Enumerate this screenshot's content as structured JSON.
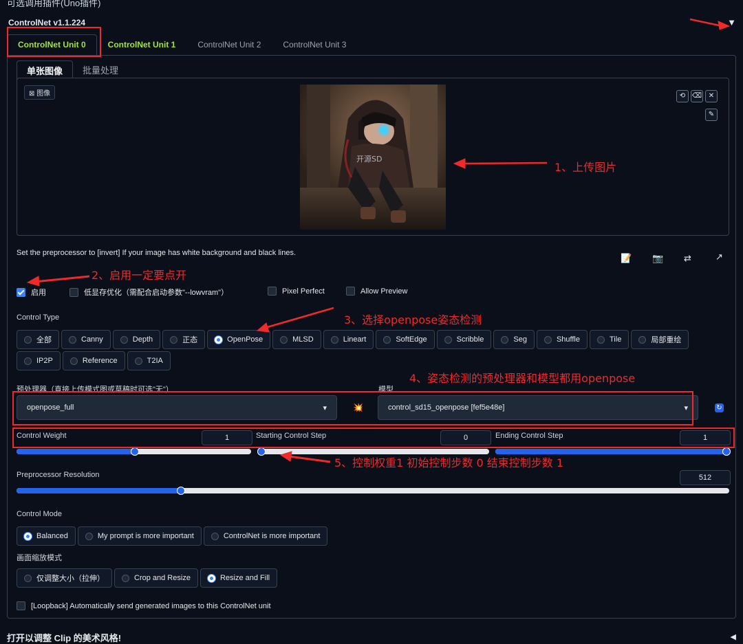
{
  "header": {
    "top_strip": "可选调用插件(Uno插件)",
    "title": "ControlNet v1.1.224",
    "collapse_icon": "triangle-down-icon"
  },
  "tabs": [
    "ControlNet Unit 0",
    "ControlNet Unit 1",
    "ControlNet Unit 2",
    "ControlNet Unit 3"
  ],
  "subtabs": [
    "单张图像",
    "批量处理"
  ],
  "image_panel": {
    "label": "图像",
    "watermark": "开源SD",
    "tool_icons": [
      "rotate-icon",
      "erase-icon",
      "close-icon",
      "brush-icon"
    ]
  },
  "hint": "Set the preprocessor to [invert] If your image has white background and black lines.",
  "tool_row_icons": [
    "📝",
    "📷",
    "⇄",
    "↗"
  ],
  "checkboxes": [
    {
      "label": "启用",
      "checked": true
    },
    {
      "label": "低显存优化（需配合启动参数\"--lowvram\"）",
      "checked": false
    },
    {
      "label": "Pixel Perfect",
      "checked": false
    },
    {
      "label": "Allow Preview",
      "checked": false
    }
  ],
  "control_type": {
    "label": "Control Type",
    "options": [
      "全部",
      "Canny",
      "Depth",
      "正态",
      "OpenPose",
      "MLSD",
      "Lineart",
      "SoftEdge",
      "Scribble",
      "Seg",
      "Shuffle",
      "Tile",
      "局部重绘",
      "IP2P",
      "Reference",
      "T2IA"
    ],
    "selected": "OpenPose"
  },
  "preprocessor": {
    "label": "预处理器（直接上传模式图或草稿时可选\"无\"）",
    "value": "openpose_full"
  },
  "model": {
    "label": "模型",
    "value": "control_sd15_openpose [fef5e48e]"
  },
  "run_icon": "💥",
  "refresh_icon": "refresh-icon",
  "sliders": {
    "control_weight": {
      "label": "Control Weight",
      "value": "1",
      "fraction": 0.5
    },
    "starting_step": {
      "label": "Starting Control Step",
      "value": "0",
      "fraction": 0.0
    },
    "ending_step": {
      "label": "Ending Control Step",
      "value": "1",
      "fraction": 1.0
    },
    "resolution": {
      "label": "Preprocessor Resolution",
      "value": "512",
      "fraction": 0.23
    }
  },
  "control_mode": {
    "label": "Control Mode",
    "options": [
      "Balanced",
      "My prompt is more important",
      "ControlNet is more important"
    ],
    "selected": "Balanced"
  },
  "resize_mode": {
    "label": "画面缩放模式",
    "options": [
      "仅调整大小（拉伸）",
      "Crop and Resize",
      "Resize and Fill"
    ],
    "selected": "Resize and Fill"
  },
  "loopback": {
    "label": "[Loopback] Automatically send generated images to this ControlNet unit",
    "checked": false
  },
  "footer": {
    "text": "打开以调整 Clip 的美术风格!",
    "icon": "◀"
  },
  "annotations": {
    "a1": "1、上传图片",
    "a2": "2、启用一定要点开",
    "a3": "3、选择openpose姿态检测",
    "a4": "4、姿态检测的预处理器和模型都用openpose",
    "a5": "5、控制权重1    初始控制步数 0  结束控制步数 1"
  },
  "colors": {
    "annotation": "#ef2a2a",
    "accent": "#2563eb",
    "active_tab": "#a3e635",
    "background": "#0b0f19"
  }
}
